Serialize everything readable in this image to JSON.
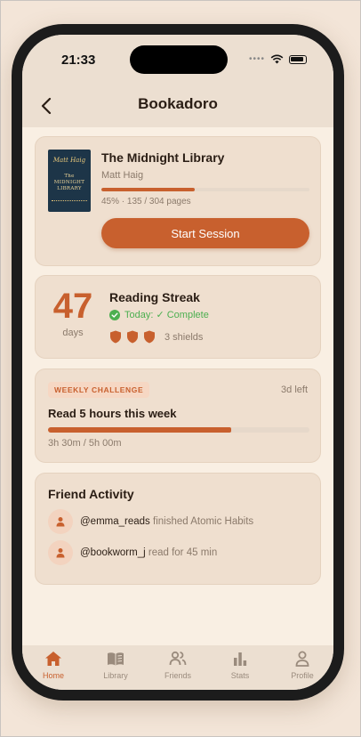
{
  "status_bar": {
    "time": "21:33",
    "signal": "••••"
  },
  "header": {
    "title": "Bookadoro"
  },
  "current_book": {
    "cover_author": "Matt Haig",
    "cover_title": "The MIDNIGHT LIBRARY",
    "title": "The Midnight Library",
    "author": "Matt Haig",
    "progress_fraction": 0.45,
    "progress_text": "45% · 135 / 304 pages",
    "start_button": "Start Session"
  },
  "streak": {
    "count": "47",
    "unit": "days",
    "title": "Reading Streak",
    "today_status": "Today: ✓ Complete",
    "shield_count": 3,
    "shields_label": "3 shields"
  },
  "challenge": {
    "badge": "WEEKLY CHALLENGE",
    "days_left": "3d left",
    "title": "Read 5 hours this week",
    "progress_fraction": 0.7,
    "progress_text": "3h 30m / 5h 00m"
  },
  "friends": {
    "title": "Friend Activity",
    "items": [
      {
        "handle": "@emma_reads",
        "action": "finished Atomic Habits"
      },
      {
        "handle": "@bookworm_j",
        "action": "read for 45 min"
      }
    ]
  },
  "tabs": [
    {
      "label": "Home",
      "icon": "home-icon",
      "active": true
    },
    {
      "label": "Library",
      "icon": "book-icon",
      "active": false
    },
    {
      "label": "Friends",
      "icon": "people-icon",
      "active": false
    },
    {
      "label": "Stats",
      "icon": "bar-chart-icon",
      "active": false
    },
    {
      "label": "Profile",
      "icon": "person-icon",
      "active": false
    }
  ],
  "colors": {
    "accent": "#c8602e",
    "success": "#4caf50",
    "card": "#efdfcf",
    "background": "#f9efe3"
  }
}
